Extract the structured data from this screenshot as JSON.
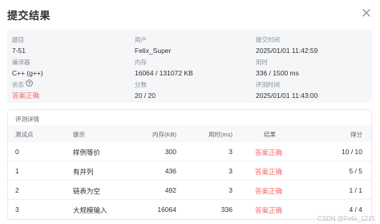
{
  "dialog": {
    "title": "提交结果"
  },
  "summary": {
    "problem_label": "题目",
    "problem_value": "7-51",
    "user_label": "用户",
    "user_value": "Felix_Super",
    "submit_time_label": "提交时间",
    "submit_time_value": "2025/01/01 11:42:59",
    "compiler_label": "编译器",
    "compiler_value": "C++ (g++)",
    "memory_label": "内存",
    "memory_value": "16064 / 131072 KB",
    "time_label": "用时",
    "time_value": "336 / 1500 ms",
    "status_label": "状态",
    "status_value": "答案正确",
    "score_label": "分数",
    "score_value": "20 / 20",
    "judge_time_label": "评测时间",
    "judge_time_value": "2025/01/01 11:43:00"
  },
  "details": {
    "title": "评测详情",
    "columns": {
      "case": "测试点",
      "hint": "提示",
      "memory": "内存(KB)",
      "time": "用时(ms)",
      "result": "结果",
      "score": "得分"
    },
    "rows": [
      {
        "case": "0",
        "hint": "样例等价",
        "memory": "300",
        "time": "3",
        "result": "答案正确",
        "score": "10 / 10"
      },
      {
        "case": "1",
        "hint": "有并列",
        "memory": "436",
        "time": "3",
        "result": "答案正确",
        "score": "5 / 5"
      },
      {
        "case": "2",
        "hint": "链表为空",
        "memory": "492",
        "time": "3",
        "result": "答案正确",
        "score": "1 / 1"
      },
      {
        "case": "3",
        "hint": "大规模输入",
        "memory": "16064",
        "time": "336",
        "result": "答案正确",
        "score": "4 / 4"
      }
    ]
  },
  "watermark": "CSDN @Felix_1215",
  "colors": {
    "success": "#f56c6c",
    "summary_bg": "#f5f6f8"
  },
  "icons": {
    "close": "close-icon",
    "help": "help-circle-icon"
  }
}
